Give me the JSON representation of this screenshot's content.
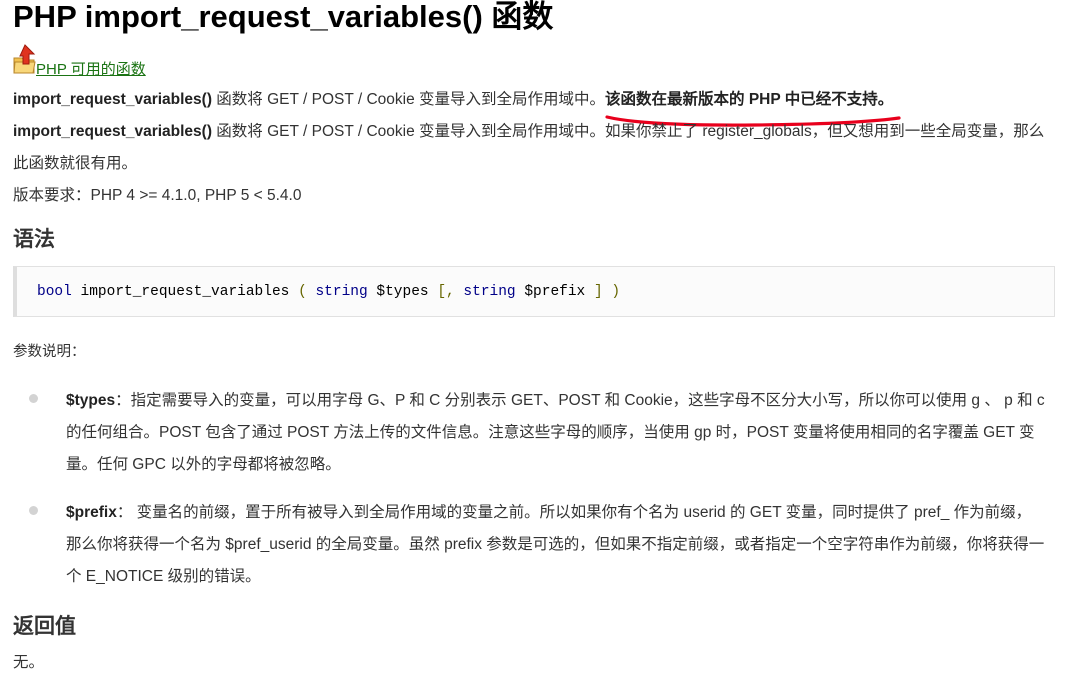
{
  "title": "PHP import_request_variables() 函数",
  "back_link": {
    "icon": "up-arrow-folder-icon",
    "label": "PHP 可用的函数"
  },
  "intro": {
    "fn_name": "import_request_variables()",
    "text": " 函数将 GET / POST / Cookie 变量导入到全局作用域中。",
    "deprecated_note": "该函数在最新版本的 PHP 中已经不支持。",
    "highlight_color": "#e8001c"
  },
  "description": {
    "fn_name": "import_request_variables()",
    "text": " 函数将 GET / POST / Cookie 变量导入到全局作用域中。如果你禁止了 register_globals，但又想用到一些全局变量，那么此函数就很有用。"
  },
  "version_requirement": "版本要求：PHP 4 >= 4.1.0, PHP 5 < 5.4.0",
  "syntax": {
    "heading": "语法",
    "code": {
      "return_type": "bool",
      "fn": "import_request_variables",
      "open": "(",
      "type1": "string",
      "arg1": "$types",
      "bracket_open": "[,",
      "type2": "string",
      "arg2": "$prefix",
      "bracket_close": "]",
      "close": ")"
    }
  },
  "params": {
    "label": "参数说明：",
    "items": [
      {
        "name": "$types",
        "separator": "：",
        "text": "指定需要导入的变量，可以用字母 G、P 和 C 分别表示 GET、POST 和 Cookie，这些字母不区分大小写，所以你可以使用 g 、 p 和 c 的任何组合。POST 包含了通过 POST 方法上传的文件信息。注意这些字母的顺序，当使用 gp 时，POST 变量将使用相同的名字覆盖 GET 变量。任何 GPC 以外的字母都将被忽略。"
      },
      {
        "name": "$prefix",
        "separator": "： ",
        "text": "变量名的前缀，置于所有被导入到全局作用域的变量之前。所以如果你有个名为 userid 的 GET 变量，同时提供了 pref_ 作为前缀，那么你将获得一个名为 $pref_userid 的全局变量。虽然 prefix 参数是可选的，但如果不指定前缀，或者指定一个空字符串作为前缀，你将获得一个 E_NOTICE 级别的错误。"
      }
    ]
  },
  "return_value": {
    "heading": "返回值",
    "text": "无。"
  }
}
